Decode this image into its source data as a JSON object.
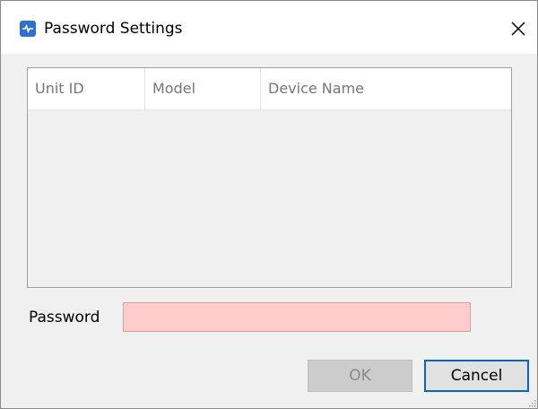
{
  "window": {
    "title": "Password Settings",
    "icon": "app-icon",
    "close_icon": "close-icon"
  },
  "table": {
    "columns": [
      "Unit ID",
      "Model",
      "Device Name"
    ],
    "rows": []
  },
  "form": {
    "password_label": "Password",
    "password_value": "",
    "password_placeholder": "",
    "password_bg_color": "#ffcccc"
  },
  "buttons": {
    "ok_label": "OK",
    "cancel_label": "Cancel"
  },
  "colors": {
    "accent": "#0a64c8",
    "app_icon": "#2f6fd0"
  }
}
